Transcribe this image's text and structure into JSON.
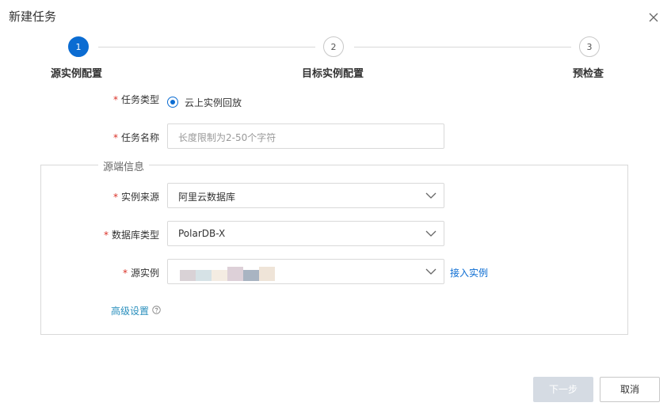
{
  "dialog": {
    "title": "新建任务"
  },
  "steps": [
    {
      "number": "1",
      "label": "源实例配置",
      "state": "active"
    },
    {
      "number": "2",
      "label": "目标实例配置",
      "state": "pending"
    },
    {
      "number": "3",
      "label": "预检查",
      "state": "pending"
    }
  ],
  "form": {
    "required_mark": "*",
    "task_type": {
      "label": "任务类型",
      "option": "云上实例回放",
      "selected": true
    },
    "task_name": {
      "label": "任务名称",
      "placeholder": "长度限制为2-50个字符",
      "value": ""
    },
    "source_section": {
      "legend": "源端信息",
      "instance_source": {
        "label": "实例来源",
        "value": "阿里云数据库"
      },
      "db_type": {
        "label": "数据库类型",
        "value": "PolarDB-X"
      },
      "source_instance": {
        "label": "源实例",
        "value": "",
        "redacted": true,
        "link": "接入实例"
      },
      "advanced": {
        "label": "高级设置",
        "icon": "question-circle-icon"
      }
    }
  },
  "footer": {
    "next_label": "下一步",
    "next_disabled": true,
    "cancel_label": "取消"
  },
  "colors": {
    "primary": "#0b6cd2",
    "required": "#d93026",
    "link_teal": "#2a8fbd",
    "disabled_button": "#d5dbe3"
  }
}
